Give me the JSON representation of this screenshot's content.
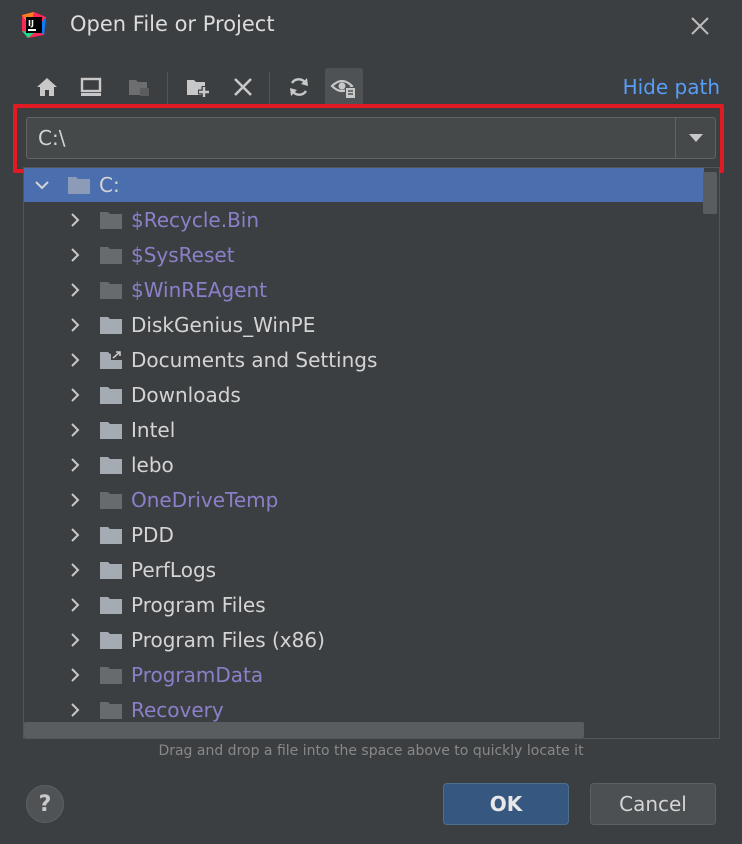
{
  "window": {
    "title": "Open File or Project",
    "app_icon": "intellij-idea-icon",
    "close_icon": "close-icon"
  },
  "toolbar": {
    "buttons": [
      {
        "name": "home-icon",
        "active": false
      },
      {
        "name": "desktop-icon",
        "active": false
      },
      {
        "name": "project-folder-icon",
        "active": false
      },
      {
        "name": "new-folder-icon",
        "active": false
      },
      {
        "name": "delete-icon",
        "active": false
      },
      {
        "name": "refresh-icon",
        "active": false
      },
      {
        "name": "show-hidden-files-icon",
        "active": true
      }
    ],
    "hide_path_label": "Hide path"
  },
  "path": {
    "value": "C:\\"
  },
  "tree": {
    "root": {
      "label": "C:",
      "expanded": true,
      "selected": true
    },
    "items": [
      {
        "label": "$Recycle.Bin",
        "hidden": true,
        "shortcut": false
      },
      {
        "label": "$SysReset",
        "hidden": true,
        "shortcut": false
      },
      {
        "label": "$WinREAgent",
        "hidden": true,
        "shortcut": false
      },
      {
        "label": "DiskGenius_WinPE",
        "hidden": false,
        "shortcut": false
      },
      {
        "label": "Documents and Settings",
        "hidden": false,
        "shortcut": true
      },
      {
        "label": "Downloads",
        "hidden": false,
        "shortcut": false
      },
      {
        "label": "Intel",
        "hidden": false,
        "shortcut": false
      },
      {
        "label": "lebo",
        "hidden": false,
        "shortcut": false
      },
      {
        "label": "OneDriveTemp",
        "hidden": true,
        "shortcut": false
      },
      {
        "label": "PDD",
        "hidden": false,
        "shortcut": false
      },
      {
        "label": "PerfLogs",
        "hidden": false,
        "shortcut": false
      },
      {
        "label": "Program Files",
        "hidden": false,
        "shortcut": false
      },
      {
        "label": "Program Files (x86)",
        "hidden": false,
        "shortcut": false
      },
      {
        "label": "ProgramData",
        "hidden": true,
        "shortcut": false
      },
      {
        "label": "Recovery",
        "hidden": true,
        "shortcut": false
      }
    ]
  },
  "hint": "Drag and drop a file into the space above to quickly locate it",
  "footer": {
    "help_label": "?",
    "ok_label": "OK",
    "cancel_label": "Cancel"
  },
  "colors": {
    "background": "#3c3f41",
    "selection": "#4b6eaf",
    "hidden_text": "#8a80c9",
    "link": "#589df6",
    "highlight_border": "#e01b24",
    "ok_button": "#365880"
  }
}
